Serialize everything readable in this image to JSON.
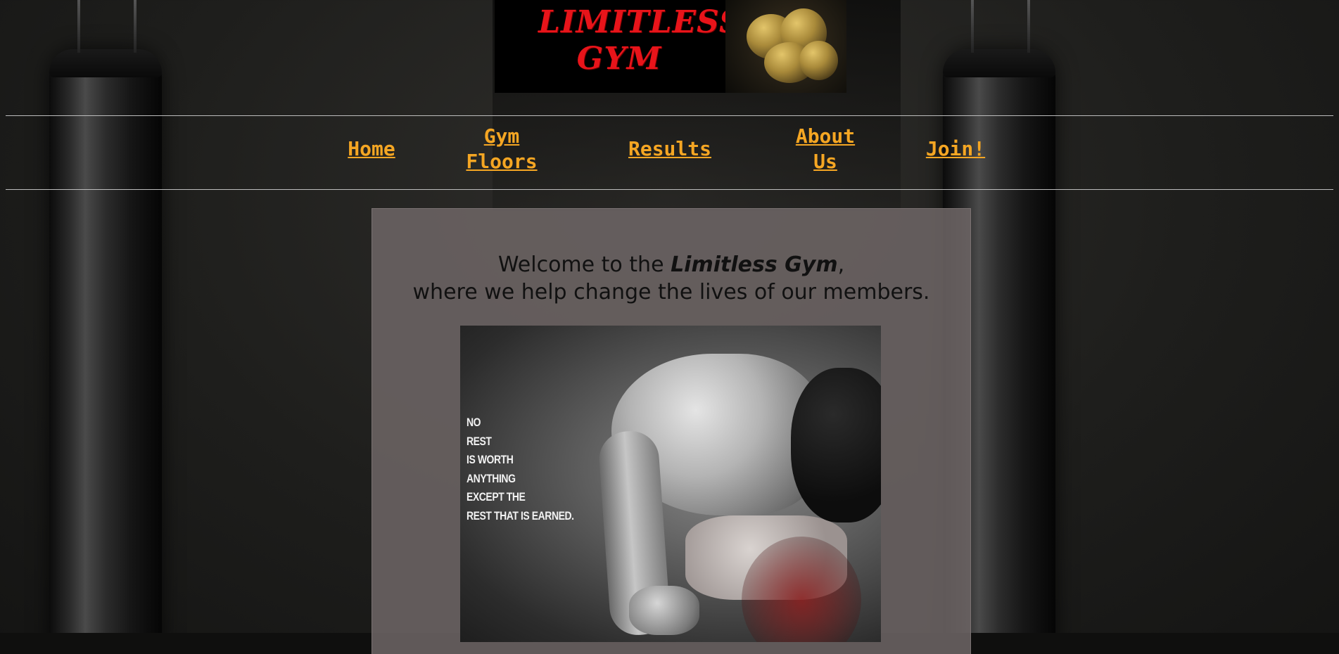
{
  "logo": {
    "line1": "LIMITLESS",
    "line2": "GYM",
    "icon": "boxing-gloves-icon"
  },
  "nav": {
    "items": [
      {
        "label": "Home"
      },
      {
        "label": "Gym\nFloors"
      },
      {
        "label": "Results"
      },
      {
        "label": "About\nUs"
      },
      {
        "label": "Join!"
      }
    ]
  },
  "welcome": {
    "prefix": "Welcome to the ",
    "brand": "Limitless Gym",
    "suffix": ",",
    "line2": "where we help change the lives of our members."
  },
  "photo": {
    "quote_lines": [
      "NO",
      "REST",
      "IS WORTH",
      "ANYTHING",
      "EXCEPT THE",
      "REST THAT IS EARNED."
    ]
  },
  "colors": {
    "nav_link": "#f5a623",
    "logo_text": "#e8141a",
    "content_bg": "#6c6464"
  }
}
